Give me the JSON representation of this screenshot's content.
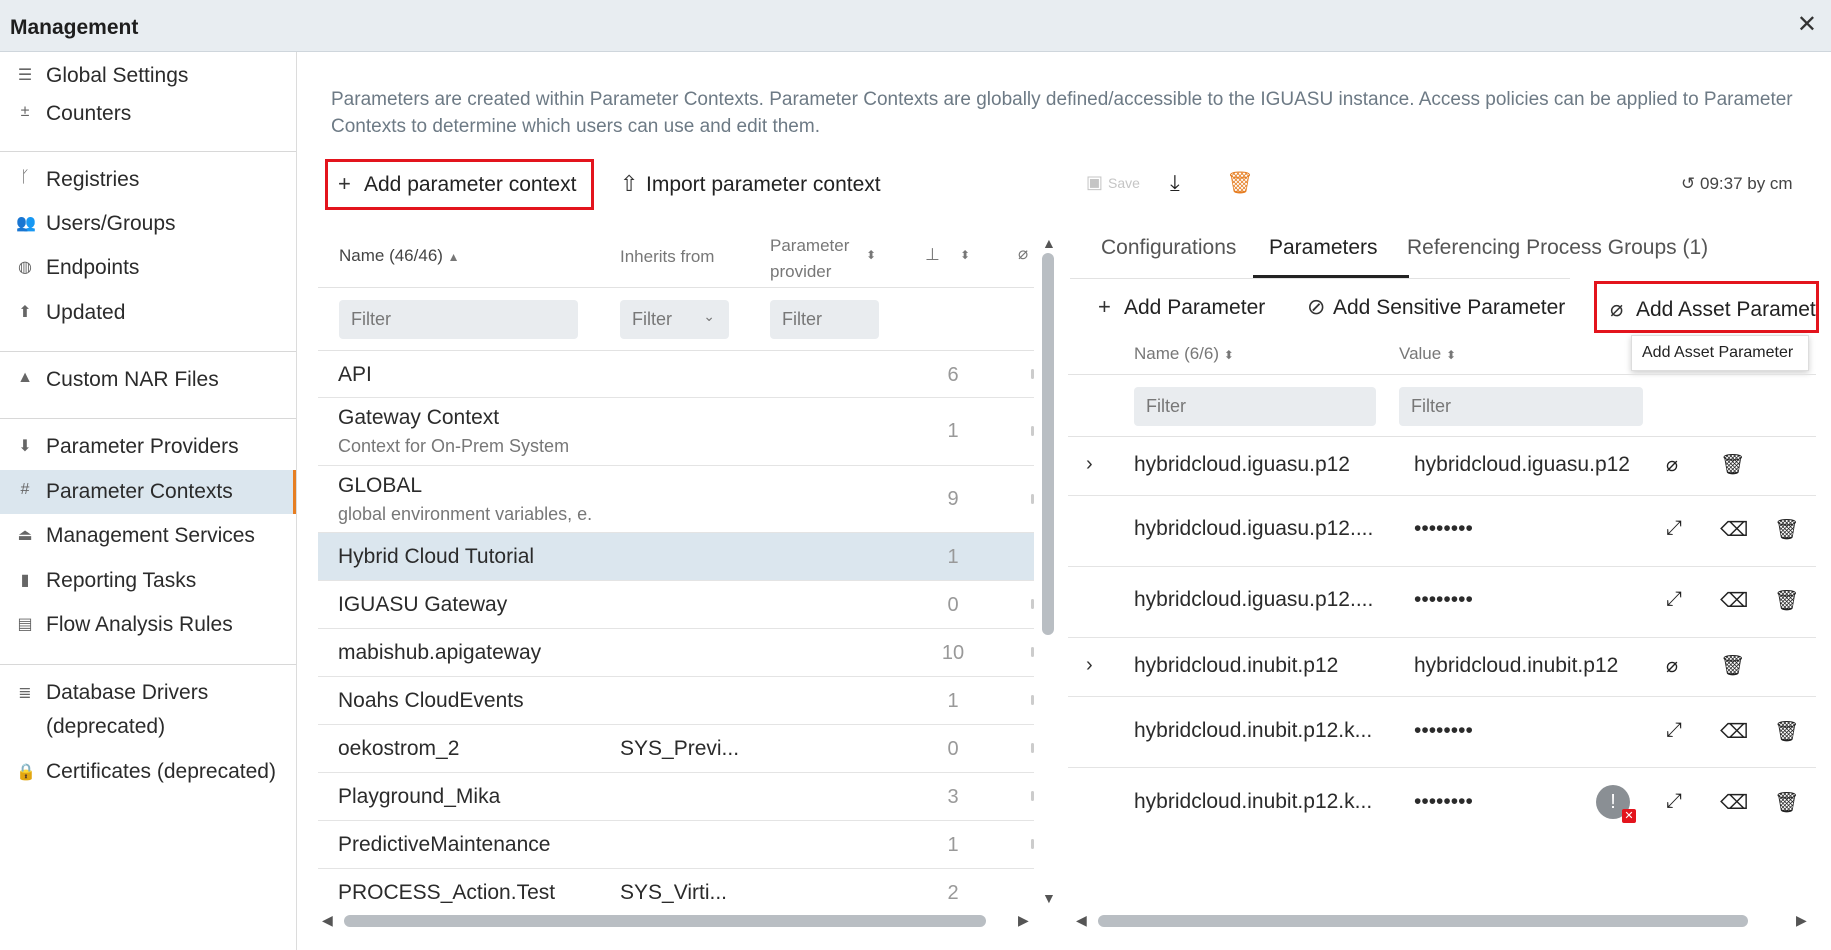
{
  "window": {
    "title": "Management"
  },
  "sidebar": {
    "items": [
      {
        "label": "Global Settings",
        "icon": "sliders-icon"
      },
      {
        "label": "Counters",
        "icon": "plus-minus-icon"
      },
      {
        "label": "Registries",
        "icon": "branch-icon"
      },
      {
        "label": "Users/Groups",
        "icon": "users-icon"
      },
      {
        "label": "Endpoints",
        "icon": "globe-icon"
      },
      {
        "label": "Updated",
        "icon": "update-icon"
      },
      {
        "label": "Custom NAR Files",
        "icon": "shapes-icon"
      },
      {
        "label": "Parameter Providers",
        "icon": "download-circle-icon"
      },
      {
        "label": "Parameter Contexts",
        "icon": "hash-icon"
      },
      {
        "label": "Management Services",
        "icon": "bell-service-icon"
      },
      {
        "label": "Reporting Tasks",
        "icon": "bar-chart-icon"
      },
      {
        "label": "Flow Analysis Rules",
        "icon": "clipboard-icon"
      },
      {
        "label": "Database Drivers (deprecated)",
        "icon": "database-icon"
      },
      {
        "label": "Certificates (deprecated)",
        "icon": "lock-icon"
      }
    ],
    "active": "Parameter Contexts"
  },
  "description": "Parameters are created within Parameter Contexts. Parameter Contexts are globally defined/accessible to the IGUASU instance. Access policies can be applied to Parameter Contexts to determine which users can use and edit them.",
  "left_toolbar": {
    "add_label": "Add parameter context",
    "import_label": "Import parameter context"
  },
  "contexts_table": {
    "headers": {
      "name": "Name (46/46)",
      "inherits": "Inherits from",
      "provider_line1": "Parameter",
      "provider_line2": "provider"
    },
    "filter_placeholder": "Filter",
    "inherits_filter": "Filter",
    "provider_filter": "Filter",
    "rows": [
      {
        "name": "API",
        "sub": "",
        "inherits": "",
        "count": "6"
      },
      {
        "name": "Gateway Context",
        "sub": "Context for On-Prem System",
        "inherits": "",
        "count": "1"
      },
      {
        "name": "GLOBAL",
        "sub": "global environment variables, e.",
        "inherits": "",
        "count": "9"
      },
      {
        "name": "Hybrid Cloud Tutorial",
        "sub": "",
        "inherits": "",
        "count": "1"
      },
      {
        "name": "IGUASU Gateway",
        "sub": "",
        "inherits": "",
        "count": "0"
      },
      {
        "name": "mabishub.apigateway",
        "sub": "",
        "inherits": "",
        "count": "10"
      },
      {
        "name": "Noahs CloudEvents",
        "sub": "",
        "inherits": "",
        "count": "1"
      },
      {
        "name": "oekostrom_2",
        "sub": "",
        "inherits": "SYS_Previ...",
        "count": "0"
      },
      {
        "name": "Playground_Mika",
        "sub": "",
        "inherits": "",
        "count": "3"
      },
      {
        "name": "PredictiveMaintenance",
        "sub": "",
        "inherits": "",
        "count": "1"
      },
      {
        "name": "PROCESS_Action.Test",
        "sub": "",
        "inherits": "SYS_Virti...",
        "count": "2"
      }
    ]
  },
  "right_toolbar": {
    "save_label": "Save",
    "timestamp": "09:37 by cm"
  },
  "tabs": [
    "Configurations",
    "Parameters",
    "Referencing Process Groups (1)"
  ],
  "active_tab": "Parameters",
  "param_actions": {
    "add": "Add Parameter",
    "add_sensitive": "Add Sensitive Parameter",
    "add_asset": "Add Asset Parameter",
    "tooltip": "Add Asset Parameter"
  },
  "params_table": {
    "headers": {
      "name": "Name (6/6)",
      "value": "Value"
    },
    "name_filter": "Filter",
    "value_filter": "Filter",
    "rows": [
      {
        "name": "hybridcloud.iguasu.p12",
        "value": "hybridcloud.iguasu.p12",
        "expandable": true
      },
      {
        "name": "hybridcloud.iguasu.p12....",
        "value": "••••••••",
        "expandable": false
      },
      {
        "name": "hybridcloud.iguasu.p12....",
        "value": "••••••••",
        "expandable": false
      },
      {
        "name": "hybridcloud.inubit.p12",
        "value": "hybridcloud.inubit.p12",
        "expandable": true
      },
      {
        "name": "hybridcloud.inubit.p12.k...",
        "value": "••••••••",
        "expandable": false
      },
      {
        "name": "hybridcloud.inubit.p12.k...",
        "value": "••••••••",
        "expandable": false
      }
    ]
  },
  "colors": {
    "accent": "#e67e22",
    "highlight": "#e3141d",
    "selected_row": "#dbe6ee"
  }
}
